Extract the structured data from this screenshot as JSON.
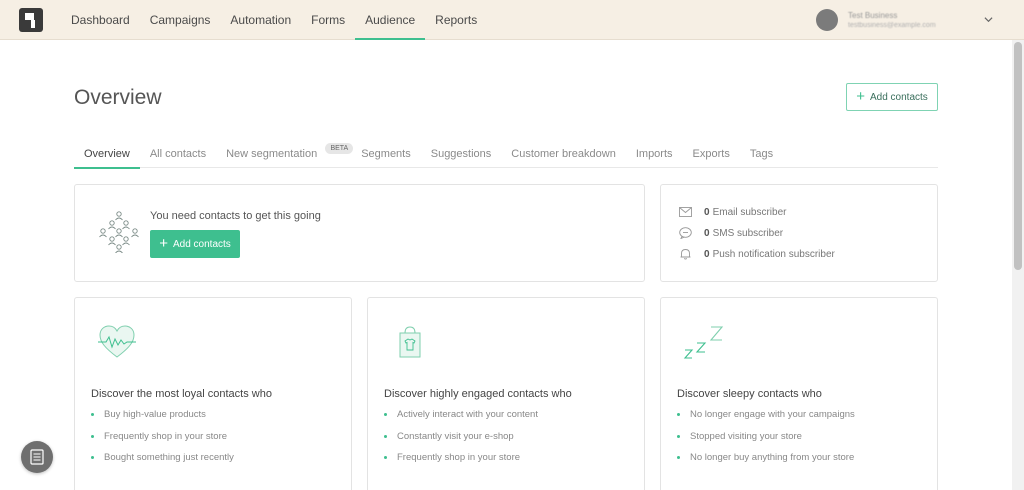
{
  "nav": {
    "items": [
      {
        "label": "Dashboard"
      },
      {
        "label": "Campaigns"
      },
      {
        "label": "Automation"
      },
      {
        "label": "Forms"
      },
      {
        "label": "Audience",
        "active": true
      },
      {
        "label": "Reports"
      }
    ]
  },
  "user": {
    "name": "Test Business",
    "email": "testbusiness@example.com"
  },
  "header": {
    "title": "Overview",
    "add_contacts_label": "Add contacts"
  },
  "tabs": [
    {
      "label": "Overview",
      "active": true
    },
    {
      "label": "All contacts"
    },
    {
      "label": "New segmentation",
      "badge": "BETA"
    },
    {
      "label": "Segments"
    },
    {
      "label": "Suggestions"
    },
    {
      "label": "Customer breakdown"
    },
    {
      "label": "Imports"
    },
    {
      "label": "Exports"
    },
    {
      "label": "Tags"
    }
  ],
  "empty_state": {
    "message": "You need contacts to get this going",
    "button_label": "Add contacts"
  },
  "stats": [
    {
      "count": "0",
      "label": "Email subscriber",
      "icon": "envelope-icon"
    },
    {
      "count": "0",
      "label": "SMS subscriber",
      "icon": "chat-bubble-icon"
    },
    {
      "count": "0",
      "label": "Push notification subscriber",
      "icon": "bell-icon"
    }
  ],
  "segments": [
    {
      "icon": "heart-pulse-icon",
      "title": "Discover the most loyal contacts who",
      "items": [
        "Buy high-value products",
        "Frequently shop in your store",
        "Bought something just recently"
      ]
    },
    {
      "icon": "shopping-bag-icon",
      "title": "Discover highly engaged contacts who",
      "items": [
        "Actively interact with your content",
        "Constantly visit your e-shop",
        "Frequently shop in your store"
      ]
    },
    {
      "icon": "sleep-zzz-icon",
      "title": "Discover sleepy contacts who",
      "items": [
        "No longer engage with your campaigns",
        "Stopped visiting your store",
        "No longer buy anything from your store"
      ]
    }
  ],
  "colors": {
    "accent": "#3ebf8f",
    "topbar": "#f6efe4"
  }
}
